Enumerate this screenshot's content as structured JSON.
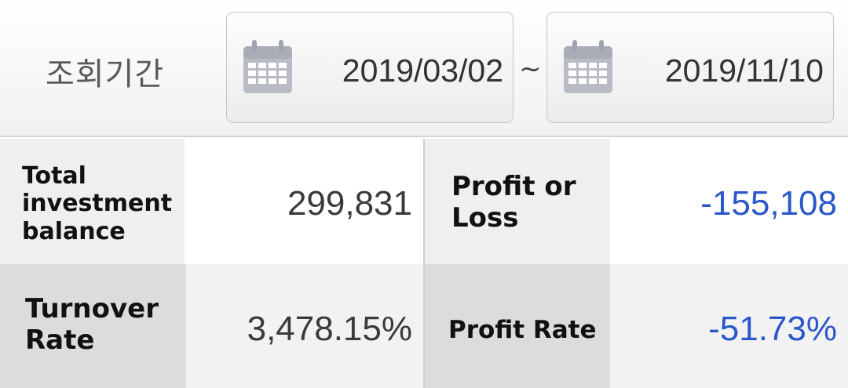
{
  "filter": {
    "period_label": "조회기간",
    "start_date": "2019/03/02",
    "separator": "~",
    "end_date": "2019/11/10",
    "calendar_icon": "calendar-icon"
  },
  "summary": {
    "total_investment_balance": {
      "label": "Total investment balance",
      "value": "299,831"
    },
    "profit_or_loss": {
      "label": "Profit or Loss",
      "value": "-155,108"
    },
    "turnover_rate": {
      "label": "Turnover Rate",
      "value": "3,478.15%"
    },
    "profit_rate": {
      "label": "Profit Rate",
      "value": "-51.73%"
    }
  },
  "colors": {
    "negative_value": "#2a57c9",
    "neutral_value": "#3a3a3a",
    "label_bg": "#efefef"
  }
}
